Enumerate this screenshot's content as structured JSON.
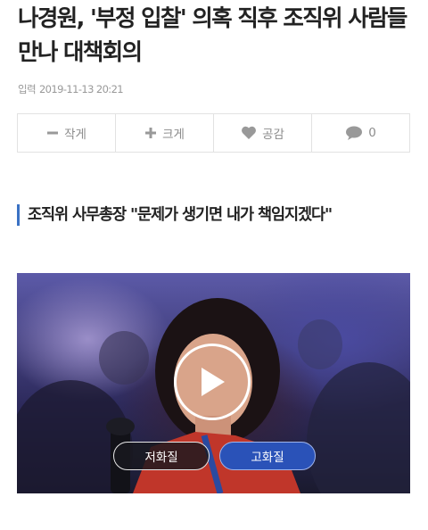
{
  "article": {
    "headline": "나경원, '부정 입찰' 의혹 직후 조직위 사람들 만나 대책회의",
    "date_label": "입력",
    "date_value": "2019-11-13 20:21",
    "subheading": "조직위 사무총장 \"문제가 생기면 내가 책임지겠다\""
  },
  "toolbar": {
    "font_smaller": {
      "icon": "minus-icon",
      "label": "작게"
    },
    "font_larger": {
      "icon": "plus-icon",
      "label": "크게"
    },
    "like": {
      "icon": "heart-icon",
      "label": "공감"
    },
    "comments": {
      "icon": "speech-bubble-icon",
      "count": "0"
    }
  },
  "video": {
    "play_icon": "play-icon",
    "quality_low": "저화질",
    "quality_high": "고화질"
  },
  "colors": {
    "accent_bar": "#3a72c4",
    "quality_high_bg": "#2a52b8",
    "icon_gray": "#999999"
  }
}
